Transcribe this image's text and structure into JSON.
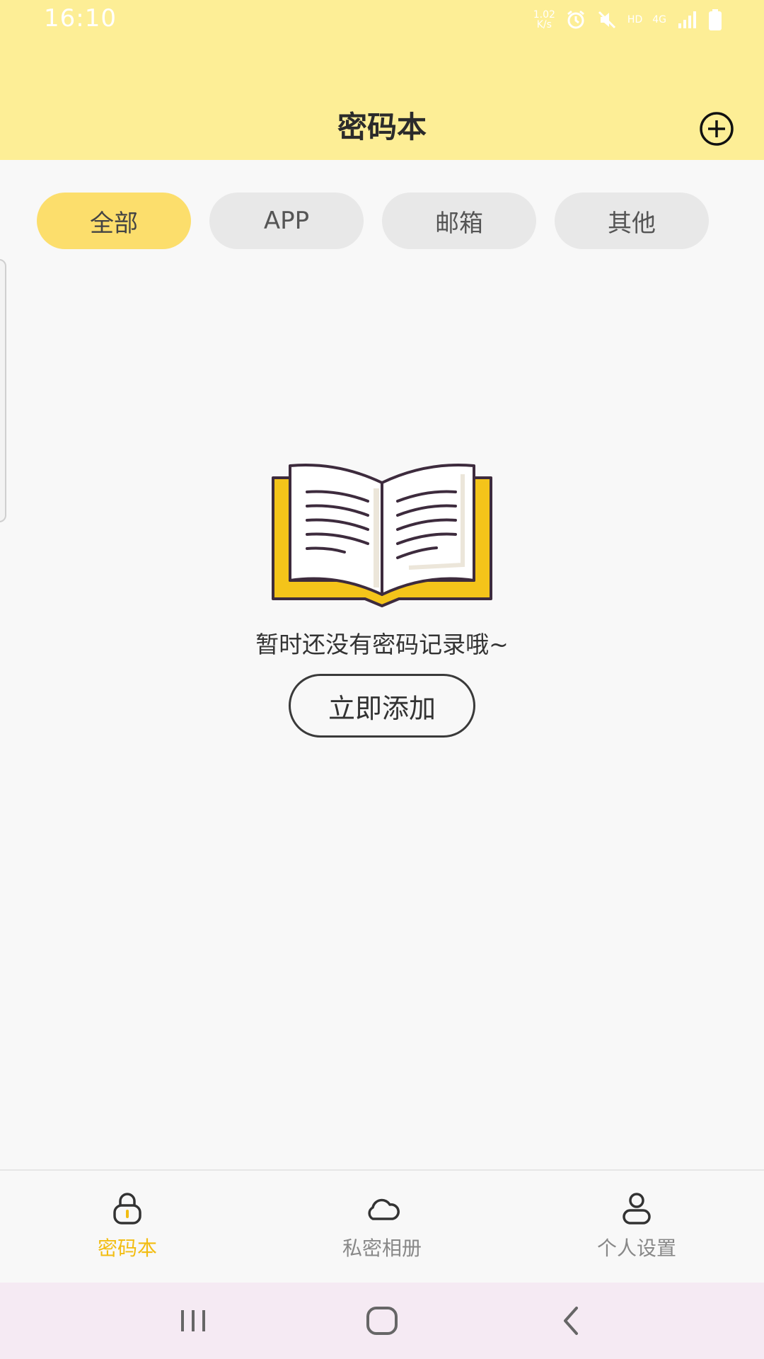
{
  "status_bar": {
    "time": "16:10",
    "net_speed_value": "1.02",
    "net_speed_unit": "K/s",
    "hd_label": "HD",
    "network_label": "4G"
  },
  "header": {
    "title": "密码本",
    "add_icon": "plus-circle-icon"
  },
  "tabs": [
    {
      "label": "全部",
      "active": true
    },
    {
      "label": "APP",
      "active": false
    },
    {
      "label": "邮箱",
      "active": false
    },
    {
      "label": "其他",
      "active": false
    }
  ],
  "empty_state": {
    "icon": "open-book-icon",
    "message": "暂时还没有密码记录哦~",
    "button_label": "立即添加"
  },
  "bottom_nav": [
    {
      "label": "密码本",
      "icon": "lock-icon",
      "active": true
    },
    {
      "label": "私密相册",
      "icon": "cloud-icon",
      "active": false
    },
    {
      "label": "个人设置",
      "icon": "user-icon",
      "active": false
    }
  ],
  "colors": {
    "header_bg": "#fdee96",
    "active_tab": "#fcde6c",
    "accent": "#f2bd12",
    "book_yellow": "#f4c41a"
  }
}
